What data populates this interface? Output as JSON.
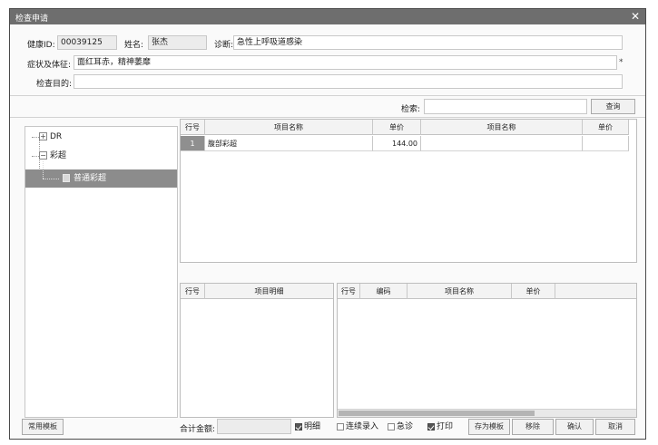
{
  "window": {
    "title": "检查申请",
    "close_glyph": "✕"
  },
  "patient": {
    "health_id_label": "健康ID:",
    "health_id_value": "00039125",
    "name_label": "姓名:",
    "name_value": "张杰",
    "diagnosis_label": "诊断:",
    "diagnosis_value": "急性上呼吸道感染"
  },
  "symptoms": {
    "label": "症状及体征:",
    "value": "面红耳赤，精神萎靡",
    "required_mark": "*"
  },
  "purpose": {
    "label": "检查目的:",
    "value": ""
  },
  "search": {
    "label": "检索:",
    "value": "",
    "button": "查询"
  },
  "tree": {
    "nodes": [
      {
        "label": "DR",
        "toggle": "+"
      },
      {
        "label": "彩超",
        "toggle": "−"
      }
    ],
    "selected_leaf": "普通彩超"
  },
  "items_table": {
    "columns": [
      "行号",
      "项目名称",
      "单价",
      "项目名称",
      "单价"
    ],
    "rows": [
      {
        "row": "1",
        "name": "腹部彩超",
        "price": "144.00",
        "name2": "",
        "price2": ""
      }
    ]
  },
  "detail_table": {
    "columns": [
      "行号",
      "项目明细"
    ]
  },
  "selected_table": {
    "columns": [
      "行号",
      "编码",
      "项目名称",
      "单价"
    ]
  },
  "footer": {
    "template_button": "常用模板",
    "total_label": "合计金额:",
    "total_value": "",
    "checks": [
      {
        "label": "明细",
        "checked": true
      },
      {
        "label": "连续录入",
        "checked": false
      },
      {
        "label": "急诊",
        "checked": false
      },
      {
        "label": "打印",
        "checked": true
      }
    ],
    "save_template_button": "存为模板",
    "remove_button": "移除",
    "confirm_button": "确认",
    "cancel_button": "取消"
  }
}
